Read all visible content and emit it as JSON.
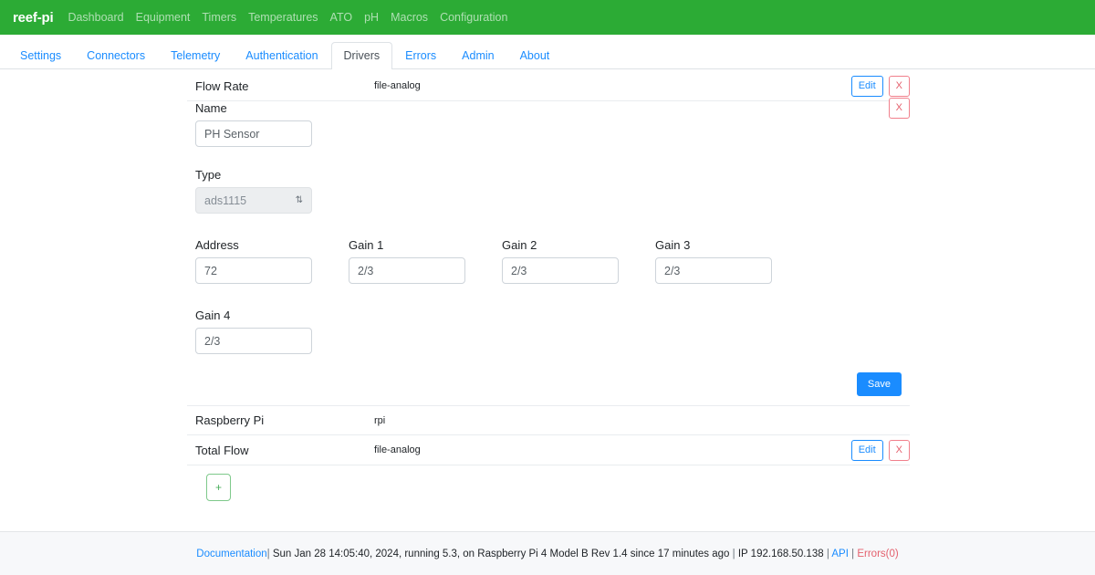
{
  "navbar": {
    "brand": "reef-pi",
    "links": [
      {
        "label": "Dashboard"
      },
      {
        "label": "Equipment"
      },
      {
        "label": "Timers"
      },
      {
        "label": "Temperatures"
      },
      {
        "label": "ATO"
      },
      {
        "label": "pH"
      },
      {
        "label": "Macros"
      },
      {
        "label": "Configuration"
      }
    ]
  },
  "tabs": [
    {
      "label": "Settings",
      "active": false
    },
    {
      "label": "Connectors",
      "active": false
    },
    {
      "label": "Telemetry",
      "active": false
    },
    {
      "label": "Authentication",
      "active": false
    },
    {
      "label": "Drivers",
      "active": true
    },
    {
      "label": "Errors",
      "active": false
    },
    {
      "label": "Admin",
      "active": false
    },
    {
      "label": "About",
      "active": false
    }
  ],
  "drivers": {
    "top_row": {
      "name": "Flow Rate",
      "type": "file-analog",
      "edit_label": "Edit",
      "delete_label": "X"
    },
    "bottom_rows": [
      {
        "name": "Raspberry Pi",
        "type": "rpi",
        "has_actions": false
      },
      {
        "name": "Total Flow",
        "type": "file-analog",
        "has_actions": true,
        "edit_label": "Edit",
        "delete_label": "X"
      }
    ],
    "add_label": "+"
  },
  "form": {
    "close_label": "X",
    "name": {
      "label": "Name",
      "value": "PH Sensor",
      "placeholder": "Name"
    },
    "type": {
      "label": "Type",
      "value": "ads1115",
      "arrow": "⇅"
    },
    "address": {
      "label": "Address",
      "value": "72",
      "placeholder": "Address"
    },
    "gain1": {
      "label": "Gain 1",
      "value": "2/3",
      "placeholder": "Gain 1"
    },
    "gain2": {
      "label": "Gain 2",
      "value": "2/3",
      "placeholder": "Gain 2"
    },
    "gain3": {
      "label": "Gain 3",
      "value": "2/3",
      "placeholder": "Gain 3"
    },
    "gain4": {
      "label": "Gain 4",
      "value": "2/3",
      "placeholder": "Gain 4"
    },
    "save_label": "Save"
  },
  "footer": {
    "documentation": "Documentation",
    "sep1": "|",
    "status": "Sun Jan 28 14:05:40, 2024,  running 5.3, on Raspberry Pi 4 Model B Rev 1.4  since 17 minutes ago",
    "sep2": "|",
    "ip": "IP 192.168.50.138",
    "sep3": "|",
    "api": "API",
    "sep4": "|",
    "errors": "Errors(0)"
  },
  "colors": {
    "navbar_green": "#2cab35",
    "link_blue": "#1a8cff",
    "danger_red": "#e4606d",
    "success_green": "#4aae5c",
    "footer_bg": "#f7f8fa"
  }
}
